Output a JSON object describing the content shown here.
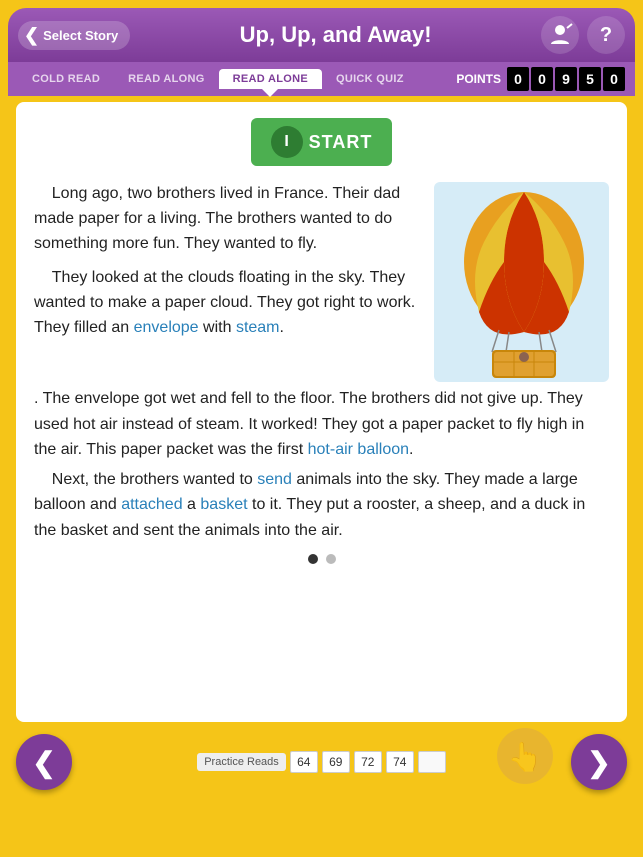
{
  "app": {
    "background_color": "#f5c518"
  },
  "header": {
    "back_label": "Select Story",
    "title": "Up, Up, and Away!",
    "teacher_icon": "teacher-icon",
    "help_icon": "help-icon"
  },
  "nav": {
    "tabs": [
      {
        "id": "cold-read",
        "label": "COLD READ",
        "active": false
      },
      {
        "id": "read-along",
        "label": "READ ALONG",
        "active": false
      },
      {
        "id": "read-alone",
        "label": "READ ALONE",
        "active": true
      },
      {
        "id": "quick-quiz",
        "label": "QUICK QUIZ",
        "active": false
      }
    ],
    "points_label": "POINTS",
    "points_digits": [
      "0",
      "0",
      "9",
      "5",
      "0"
    ]
  },
  "start_button": {
    "label": "START"
  },
  "reading": {
    "paragraph1": "Long ago, two brothers lived in France. Their dad made paper for a living. The brothers wanted to do something more fun. They wanted to fly.",
    "paragraph2": "They looked at the clouds floating in the sky. They wanted to make a paper cloud. They got right to work. They filled an",
    "vocab1": "envelope",
    "p2_mid": "with",
    "vocab2": "steam",
    "paragraph2b": ". The envelope got wet and fell to the floor. The brothers did not give up. They used hot air instead of steam. It worked! They got a paper packet to fly high in the air. This paper packet was the first",
    "vocab3": "hot-air balloon",
    "paragraph2c": ".",
    "paragraph3_start": "Next, the brothers wanted to",
    "vocab4": "send",
    "paragraph3_mid": "animals into the sky. They made a large balloon and",
    "vocab5": "attached",
    "paragraph3_mid2": "a",
    "vocab6": "basket",
    "paragraph3_end": "to it. They put a rooster, a sheep, and a duck in the basket and sent the animals into the air."
  },
  "pagination": {
    "dots": [
      {
        "active": true
      },
      {
        "active": false
      }
    ]
  },
  "practice_reads": {
    "label": "Practice Reads",
    "values": [
      "64",
      "69",
      "72",
      "74",
      ""
    ]
  },
  "nav_buttons": {
    "prev_label": "❮",
    "next_label": "❯"
  }
}
